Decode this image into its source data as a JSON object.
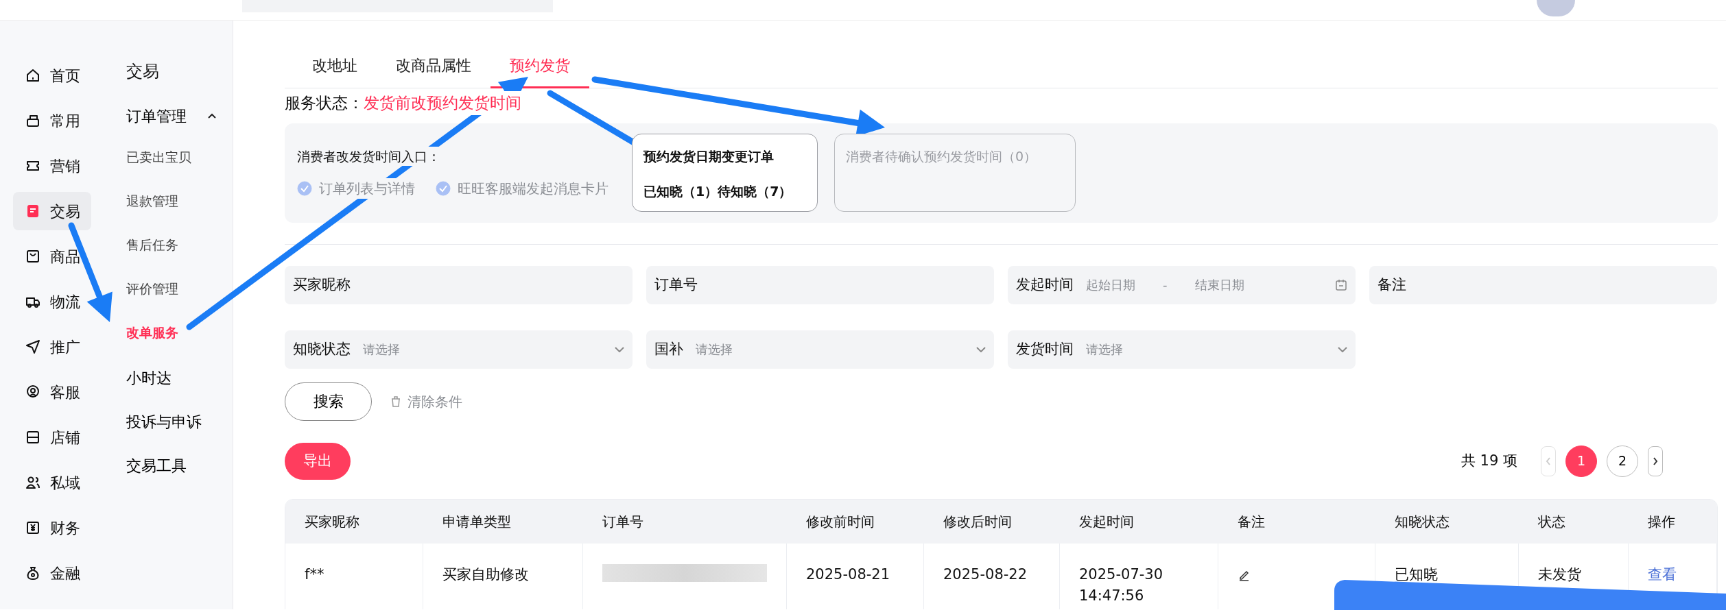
{
  "nav": [
    {
      "label": "首页",
      "selected": false
    },
    {
      "label": "常用",
      "selected": false
    },
    {
      "label": "营销",
      "selected": false
    },
    {
      "label": "交易",
      "selected": true
    },
    {
      "label": "商品",
      "selected": false
    },
    {
      "label": "物流",
      "selected": false
    },
    {
      "label": "推广",
      "selected": false
    },
    {
      "label": "客服",
      "selected": false
    },
    {
      "label": "店铺",
      "selected": false
    },
    {
      "label": "私域",
      "selected": false
    },
    {
      "label": "财务",
      "selected": false
    },
    {
      "label": "金融",
      "selected": false
    }
  ],
  "subnav": {
    "title": "交易",
    "group": {
      "label": "订单管理",
      "expanded": true,
      "children": [
        {
          "label": "已卖出宝贝",
          "selected": false
        },
        {
          "label": "退款管理",
          "selected": false
        },
        {
          "label": "售后任务",
          "selected": false
        },
        {
          "label": "评价管理",
          "selected": false
        },
        {
          "label": "改单服务",
          "selected": true
        }
      ]
    },
    "items": [
      "小时达",
      "投诉与申诉",
      "交易工具"
    ]
  },
  "tabs": [
    {
      "label": "改地址",
      "selected": false
    },
    {
      "label": "改商品属性",
      "selected": false
    },
    {
      "label": "预约发货",
      "selected": true
    }
  ],
  "service_status": {
    "label": "服务状态：",
    "value": "发货前改预约发货时间"
  },
  "entry_panel": {
    "title": "消费者改发货时间入口：",
    "options": [
      {
        "label": "订单列表与详情",
        "checked": true
      },
      {
        "label": "旺旺客服端发起消息卡片",
        "checked": true
      }
    ]
  },
  "stat_cards": [
    {
      "title": "预约发货日期变更订单",
      "detail": "已知晓（1）待知晓（7）",
      "disabled": false
    },
    {
      "title": "消费者待确认预约发货时间（0）",
      "disabled": true
    }
  ],
  "filters": [
    {
      "kind": "text",
      "label": "买家昵称"
    },
    {
      "kind": "text",
      "label": "订单号"
    },
    {
      "kind": "daterange",
      "label": "发起时间",
      "start_placeholder": "起始日期",
      "separator": "-",
      "end_placeholder": "结束日期"
    },
    {
      "kind": "text",
      "label": "备注"
    },
    {
      "kind": "select",
      "label": "知晓状态",
      "placeholder": "请选择"
    },
    {
      "kind": "select",
      "label": "国补",
      "placeholder": "请选择"
    },
    {
      "kind": "select",
      "label": "发货时间",
      "placeholder": "请选择"
    }
  ],
  "search_button": "搜索",
  "clear_button": "清除条件",
  "export_button": "导出",
  "pagination": {
    "total": "共 19 项",
    "prev_disabled": true,
    "next_disabled": false,
    "pages": [
      {
        "label": "1",
        "selected": true
      },
      {
        "label": "2",
        "selected": false
      }
    ]
  },
  "table": {
    "columns": [
      "买家昵称",
      "申请单类型",
      "订单号",
      "修改前时间",
      "修改后时间",
      "发起时间",
      "备注",
      "知晓状态",
      "状态",
      "操作"
    ],
    "rows": [
      [
        {
          "kind": "text",
          "text": "f**"
        },
        {
          "kind": "text",
          "text": "买家自助修改"
        },
        {
          "kind": "redacted"
        },
        {
          "kind": "text",
          "text": "2025-08-21"
        },
        {
          "kind": "text",
          "text": "2025-08-22"
        },
        {
          "kind": "text",
          "text": "2025-07-30 14:47:56"
        },
        {
          "kind": "edit"
        },
        {
          "kind": "text",
          "text": "已知晓"
        },
        {
          "kind": "text",
          "text": "未发货"
        },
        {
          "kind": "link",
          "text": "查看"
        }
      ]
    ]
  }
}
